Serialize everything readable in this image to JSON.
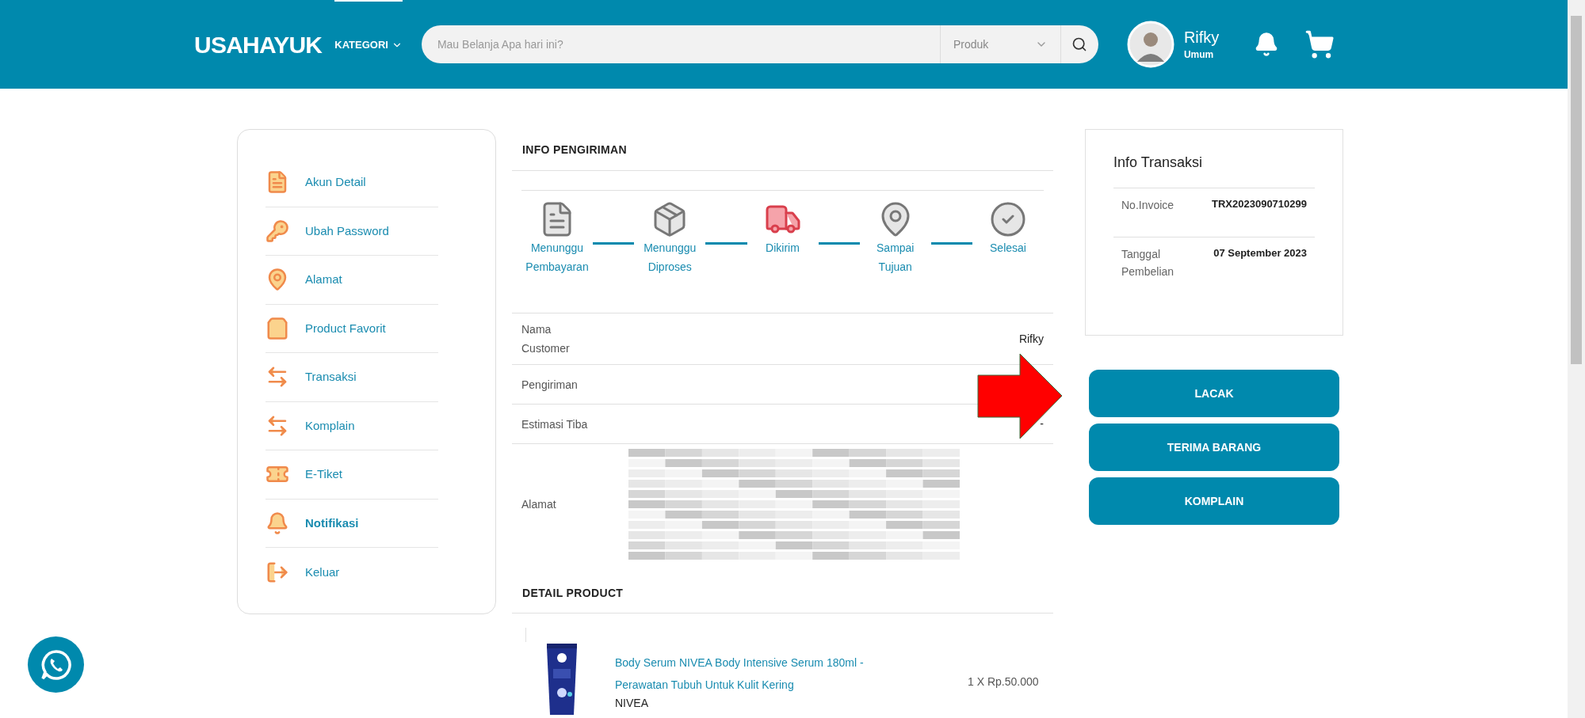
{
  "header": {
    "logo": "USAHAYUK",
    "category_menu": {
      "label": "KATEGORI",
      "selected": true
    },
    "search": {
      "placeholder": "Mau Belanja Apa hari ini?",
      "category": "Produk"
    },
    "user": {
      "name": "Rifky",
      "role": "Umum"
    }
  },
  "sidebar": {
    "items": [
      {
        "label": "Akun Detail",
        "selected": false
      },
      {
        "label": "Ubah Password",
        "selected": false
      },
      {
        "label": "Alamat",
        "selected": false
      },
      {
        "label": "Product Favorit",
        "selected": false
      },
      {
        "label": "Transaksi",
        "selected": false
      },
      {
        "label": "Komplain",
        "selected": false
      },
      {
        "label": "E-Tiket",
        "selected": false
      },
      {
        "label": "Notifikasi",
        "selected": true
      },
      {
        "label": "Keluar",
        "selected": false
      }
    ]
  },
  "shipping": {
    "title": "INFO PENGIRIMAN",
    "steps": [
      {
        "label": "Menunggu Pembayaran",
        "selected": false
      },
      {
        "label": "Menunggu Diproses",
        "selected": false
      },
      {
        "label": "Dikirim",
        "selected": true
      },
      {
        "label": "Sampai Tujuan",
        "selected": false
      },
      {
        "label": "Selesai",
        "selected": false
      }
    ],
    "rows": [
      {
        "kind": "text",
        "label": "Nama Customer",
        "value": "Rifky"
      },
      {
        "kind": "text",
        "label": "Pengiriman"
      },
      {
        "kind": "text",
        "label": "Estimasi Tiba",
        "value": "-"
      },
      {
        "kind": "redacted",
        "label": "Alamat"
      }
    ]
  },
  "product_section": {
    "title": "DETAIL PRODUCT",
    "items": [
      {
        "name": "Body Serum NIVEA Body Intensive Serum 180ml - Perawatan Tubuh Untuk Kulit Kering",
        "price": "1 X Rp.50.000",
        "brand": "NIVEA"
      }
    ]
  },
  "transaction": {
    "title": "Info Transaksi",
    "rows": [
      {
        "label": "No.Invoice",
        "value": "TRX2023090710299"
      },
      {
        "label": "Tanggal Pembelian",
        "value": "07 September 2023"
      }
    ]
  },
  "actions": [
    "LACAK",
    "TERIMA BARANG",
    "KOMPLAIN"
  ]
}
